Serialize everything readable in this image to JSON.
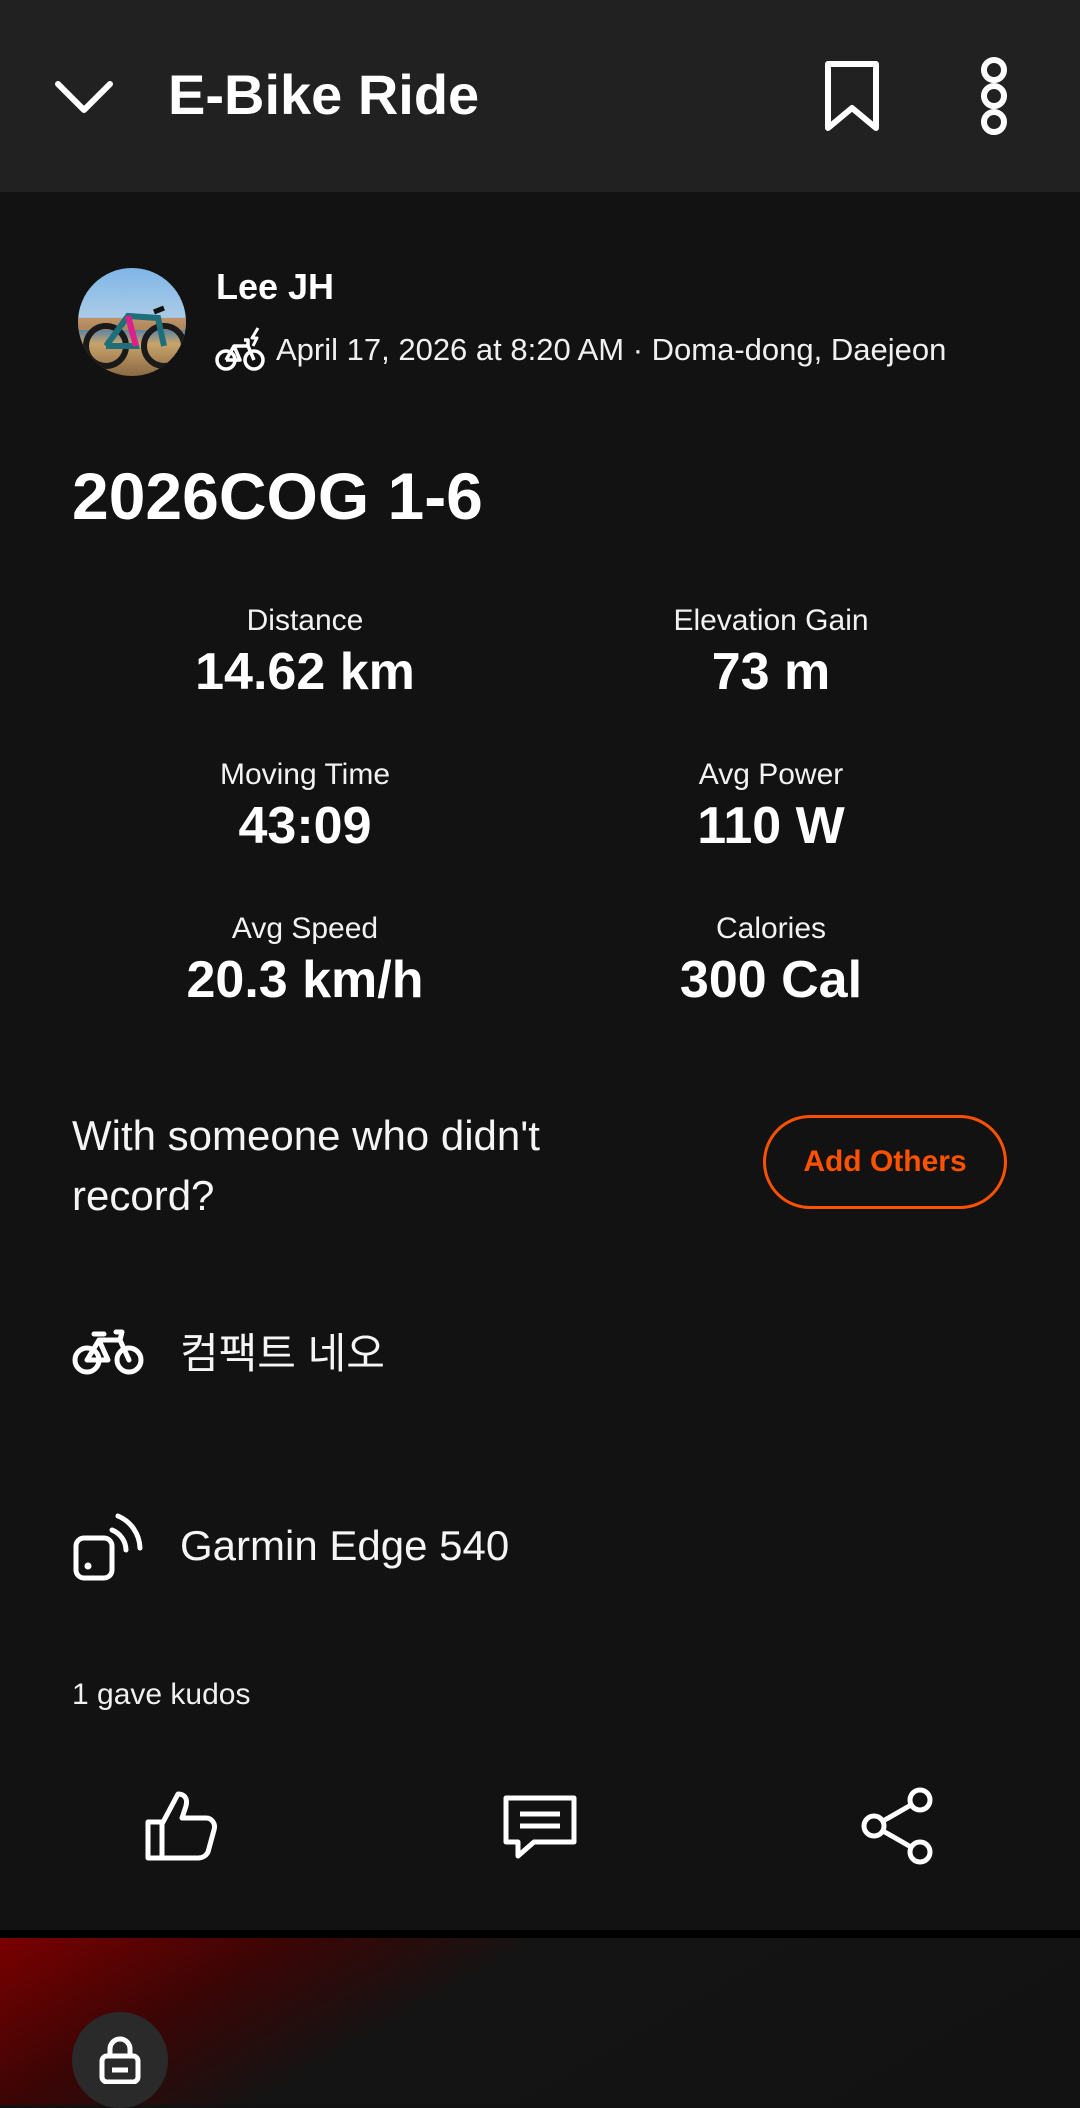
{
  "header": {
    "title": "E-Bike Ride",
    "icons": {
      "back": "chevron-down-icon",
      "bookmark": "bookmark-icon",
      "more": "more-vertical-icon"
    }
  },
  "athlete": {
    "name": "Lee JH",
    "activity_meta": "April 17, 2026 at 8:20 AM · Doma-dong, Daejeon",
    "sport_icon": "ebike-icon"
  },
  "activity": {
    "title": "2026COG 1-6"
  },
  "stats": [
    {
      "label": "Distance",
      "value": "14.62 km"
    },
    {
      "label": "Elevation Gain",
      "value": "73 m"
    },
    {
      "label": "Moving Time",
      "value": "43:09"
    },
    {
      "label": "Avg Power",
      "value": "110 W"
    },
    {
      "label": "Avg Speed",
      "value": "20.3 km/h"
    },
    {
      "label": "Calories",
      "value": "300 Cal"
    }
  ],
  "group": {
    "prompt": "With someone who didn't record?",
    "button_label": "Add Others",
    "accent": "#fc5200"
  },
  "gear": {
    "bike": "컴팩트 네오",
    "device": "Garmin Edge 540"
  },
  "social": {
    "kudos_text": "1 gave kudos",
    "icons": [
      "thumbs-up-icon",
      "comment-icon",
      "share-icon"
    ]
  },
  "colors": {
    "background": "#121212",
    "header": "#212121",
    "accent": "#fc5200"
  }
}
